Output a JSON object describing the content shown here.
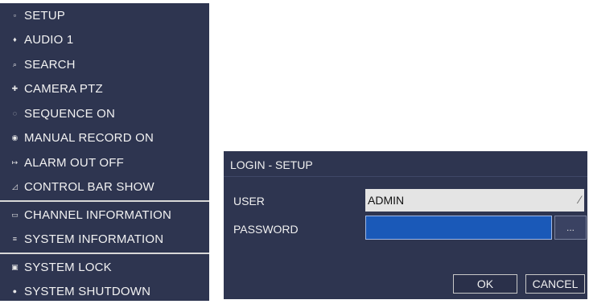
{
  "menu": {
    "items": [
      {
        "label": "SETUP",
        "icon": "setup-icon",
        "glyph": "▫"
      },
      {
        "label": "AUDIO 1",
        "icon": "audio-icon",
        "glyph": "♦"
      },
      {
        "label": "SEARCH",
        "icon": "search-icon",
        "glyph": "⌕"
      },
      {
        "label": "CAMERA PTZ",
        "icon": "ptz-icon",
        "glyph": "✚"
      },
      {
        "label": "SEQUENCE ON",
        "icon": "sequence-icon",
        "glyph": "◌"
      },
      {
        "label": "MANUAL RECORD ON",
        "icon": "record-icon",
        "glyph": "◉"
      },
      {
        "label": "ALARM OUT OFF",
        "icon": "alarm-icon",
        "glyph": "↦"
      },
      {
        "label": "CONTROL BAR SHOW",
        "icon": "control-bar-icon",
        "glyph": "◿"
      },
      {
        "label": "CHANNEL INFORMATION",
        "icon": "channel-info-icon",
        "glyph": "▭"
      },
      {
        "label": "SYSTEM INFORMATION",
        "icon": "system-info-icon",
        "glyph": "≡"
      },
      {
        "label": "SYSTEM LOCK",
        "icon": "lock-icon",
        "glyph": "▣"
      },
      {
        "label": "SYSTEM SHUTDOWN",
        "icon": "power-icon",
        "glyph": "●"
      }
    ]
  },
  "dialog": {
    "title": "LOGIN - SETUP",
    "user_label": "USER",
    "user_value": "ADMIN",
    "password_label": "PASSWORD",
    "password_value": "",
    "ellipsis_label": "...",
    "ok_label": "OK",
    "cancel_label": "CANCEL"
  },
  "colors": {
    "panel_bg": "#2e3550",
    "password_field_bg": "#1a59b8",
    "user_field_bg": "#e4e4e4"
  }
}
